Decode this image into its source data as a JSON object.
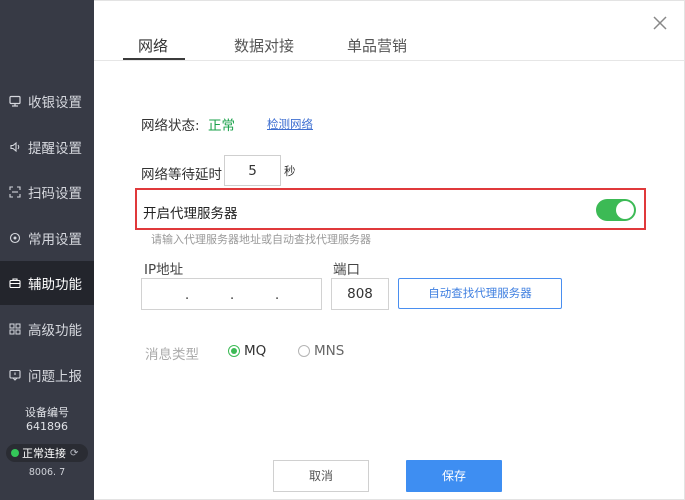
{
  "sidebar": {
    "items": [
      {
        "label": "收银设置",
        "icon": "cashier-icon"
      },
      {
        "label": "提醒设置",
        "icon": "speaker-icon"
      },
      {
        "label": "扫码设置",
        "icon": "scan-icon"
      },
      {
        "label": "常用设置",
        "icon": "gear-icon"
      },
      {
        "label": "辅助功能",
        "icon": "toolbox-icon",
        "active": true
      },
      {
        "label": "高级功能",
        "icon": "grid-icon"
      },
      {
        "label": "问题上报",
        "icon": "report-icon"
      }
    ],
    "device_label": "设备编号",
    "device_id": "641896",
    "connection_status": "正常连接",
    "version": "8006. 7"
  },
  "tabs": [
    {
      "label": "网络",
      "active": true
    },
    {
      "label": "数据对接"
    },
    {
      "label": "单品营销"
    }
  ],
  "network": {
    "status_label": "网络状态:",
    "status_value": "正常",
    "check_link": "检测网络",
    "delay_label": "网络等待延时",
    "delay_value": "5",
    "delay_unit": "秒"
  },
  "proxy": {
    "label": "开启代理服务器",
    "enabled": true,
    "hint": "请输入代理服务器地址或自动查找代理服务器",
    "ip_label": "IP地址",
    "ip_separator": ".",
    "port_label": "端口",
    "port_value": "808",
    "auto_find_button": "自动查找代理服务器"
  },
  "message": {
    "label": "消息类型",
    "options": [
      {
        "label": "MQ",
        "checked": true
      },
      {
        "label": "MNS",
        "checked": false
      }
    ]
  },
  "footer": {
    "cancel": "取消",
    "save": "保存"
  },
  "colors": {
    "sidebar_bg": "#373a45",
    "accent_green": "#3cba55",
    "primary_blue": "#3e8ef2",
    "highlight_red": "#e0393b"
  }
}
